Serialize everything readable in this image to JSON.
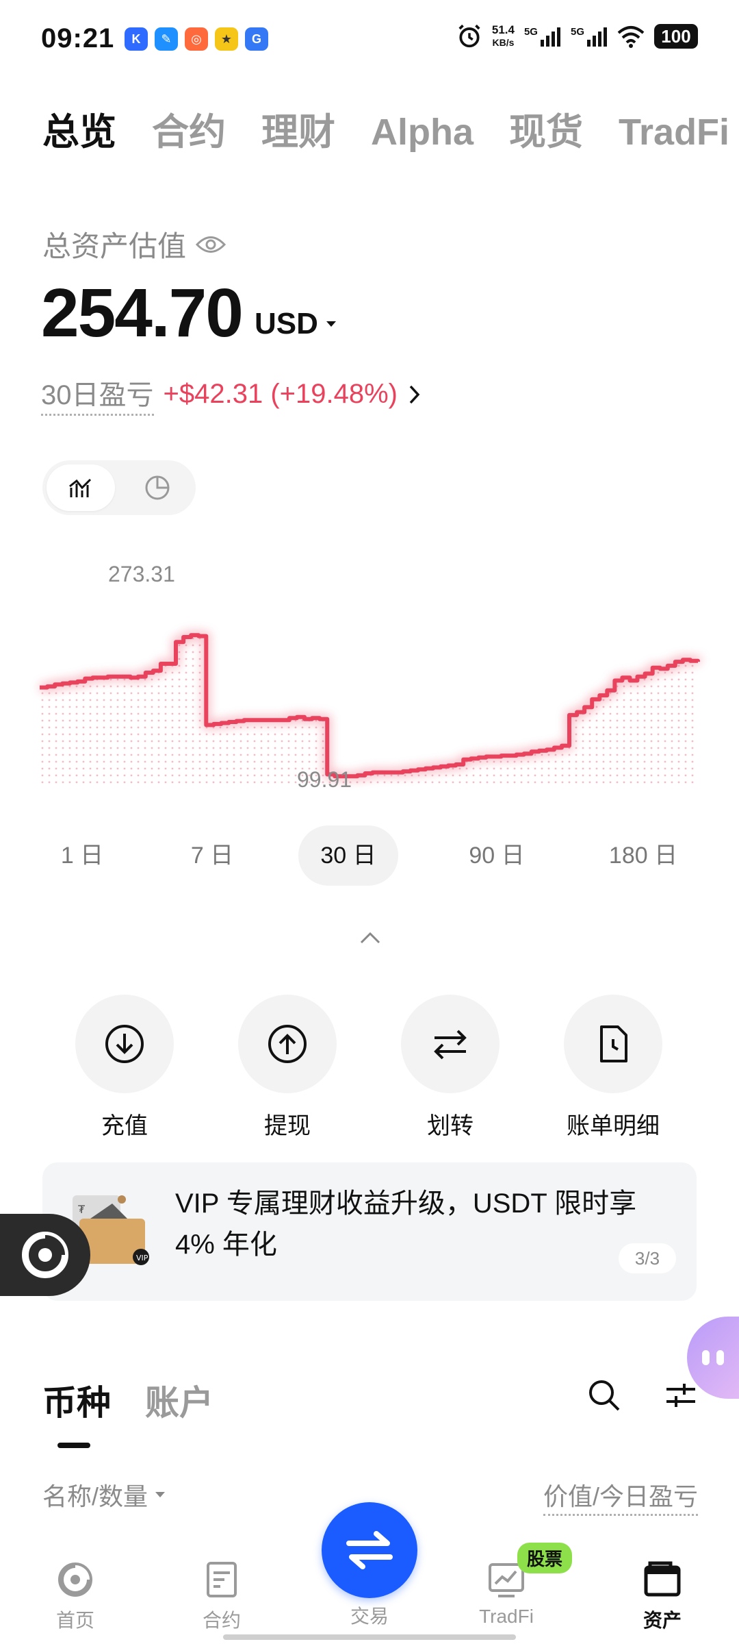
{
  "status_bar": {
    "time": "09:21",
    "net_speed_value": "51.4",
    "net_speed_unit": "KB/s",
    "sim1": "5G",
    "sim2": "5G",
    "battery": "100"
  },
  "top_tabs": [
    {
      "label": "总览",
      "active": true
    },
    {
      "label": "合约",
      "active": false
    },
    {
      "label": "理财",
      "active": false
    },
    {
      "label": "Alpha",
      "active": false
    },
    {
      "label": "现货",
      "active": false
    },
    {
      "label": "TradFi",
      "active": false
    }
  ],
  "balance": {
    "label": "总资产估值",
    "value": "254.70",
    "currency": "USD",
    "pnl_label": "30日盈亏",
    "pnl_value": "+$42.31 (+19.48%)"
  },
  "colors": {
    "accent_red": "#e8425d",
    "accent_blue": "#1a5cff",
    "badge_green": "#8ee04a"
  },
  "chart_data": {
    "type": "line",
    "series": [
      {
        "values": [
          198,
          199,
          201,
          202,
          203,
          204,
          207,
          208,
          208,
          209,
          209,
          209,
          208,
          209,
          213,
          215,
          222,
          222,
          244,
          249,
          251,
          250,
          160,
          161,
          162,
          163,
          164,
          165,
          165,
          165,
          165,
          165,
          165,
          167,
          168,
          166,
          167,
          166,
          110,
          108,
          108,
          108,
          109,
          111,
          112,
          112,
          112,
          112,
          113,
          114,
          115,
          116,
          117,
          118,
          119,
          120,
          125,
          126,
          127,
          128,
          128,
          129,
          129,
          130,
          131,
          133,
          134,
          135,
          137,
          139,
          170,
          173,
          178,
          186,
          190,
          195,
          205,
          208,
          205,
          209,
          212,
          218,
          217,
          220,
          224,
          226,
          225,
          224
        ]
      }
    ],
    "annotations": {
      "max_label": "273.31",
      "min_label": "99.91"
    }
  },
  "range_tabs": [
    {
      "label": "1 日",
      "active": false
    },
    {
      "label": "7 日",
      "active": false
    },
    {
      "label": "30 日",
      "active": true
    },
    {
      "label": "90 日",
      "active": false
    },
    {
      "label": "180 日",
      "active": false
    }
  ],
  "actions": [
    {
      "label": "充值",
      "icon": "deposit-icon"
    },
    {
      "label": "提现",
      "icon": "withdraw-icon"
    },
    {
      "label": "划转",
      "icon": "transfer-icon"
    },
    {
      "label": "账单明细",
      "icon": "bill-icon"
    }
  ],
  "banner": {
    "text": "VIP 专属理财收益升级，USDT 限时享 4% 年化",
    "page": "3/3"
  },
  "coin_tabs": [
    {
      "label": "币种",
      "active": true
    },
    {
      "label": "账户",
      "active": false
    }
  ],
  "list_header": {
    "left": "名称/数量",
    "right": "价值/今日盈亏"
  },
  "bottom_nav": {
    "items": [
      {
        "label": "首页",
        "active": false
      },
      {
        "label": "合约",
        "active": false
      },
      {
        "label": "交易",
        "active": false
      },
      {
        "label": "TradFi",
        "active": false,
        "badge": "股票"
      },
      {
        "label": "资产",
        "active": true
      }
    ]
  }
}
